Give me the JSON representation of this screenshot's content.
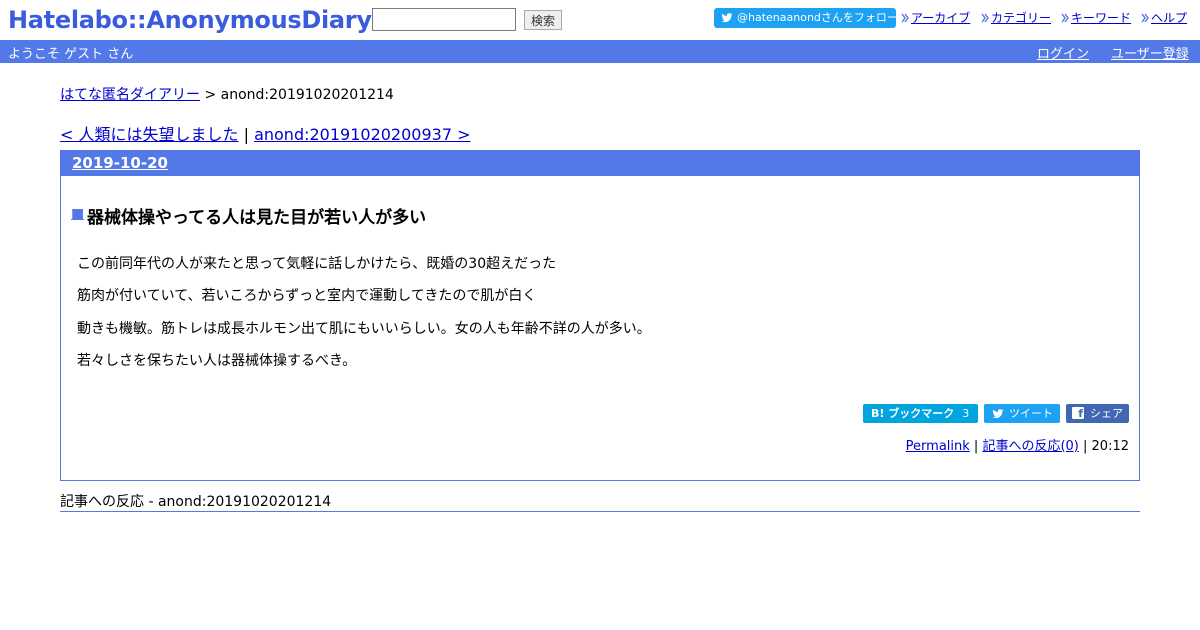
{
  "header": {
    "logo": "Hatelabo::AnonymousDiary",
    "search_value": "",
    "search_button": "検索",
    "follow_button": "@hatenaanondさんをフォロー",
    "nav": [
      "アーカイブ",
      "カテゴリー",
      "キーワード",
      "ヘルプ"
    ]
  },
  "bar": {
    "welcome": "ようこそ ゲスト さん",
    "login": "ログイン",
    "signup": "ユーザー登録"
  },
  "breadcrumb": {
    "home": "はてな匿名ダイアリー",
    "separator": " > ",
    "current": "anond:20191020201214"
  },
  "entry_nav": {
    "prev": "< 人類には失望しました",
    "separator": " | ",
    "next": "anond:20191020200937 >"
  },
  "day": {
    "date": "2019-10-20",
    "section_mark": "■",
    "title": "器械体操やってる人は見た目が若い人が多い",
    "body": [
      "この前同年代の人が来たと思って気軽に話しかけたら、既婚の30超えだった",
      "筋肉が付いていて、若いころからずっと室内で運動してきたので肌が白く",
      "動きも機敏。筋トレは成長ホルモン出て肌にもいいらしい。女の人も年齢不詳の人が多い。",
      "若々しさを保ちたい人は器械体操するべき。"
    ],
    "share": {
      "bookmark": "B! ブックマーク",
      "bookmark_count": "3",
      "tweet": "ツイート",
      "share": "シェア"
    },
    "footer": {
      "permalink": "Permalink",
      "sep1": " | ",
      "reactions": "記事への反応(0)",
      "sep2": " | ",
      "time": "20:12"
    }
  },
  "reactions_header": "記事への反応 - anond:20191020201214",
  "colors": {
    "accent": "#5279e7",
    "logo": "#3a5cdc",
    "link": "#0000cc",
    "twitter": "#1da1f2",
    "hatena": "#00a4de",
    "facebook": "#4267b2"
  },
  "icons": [
    "twitter-icon",
    "nav-arrow-icon",
    "facebook-icon"
  ]
}
